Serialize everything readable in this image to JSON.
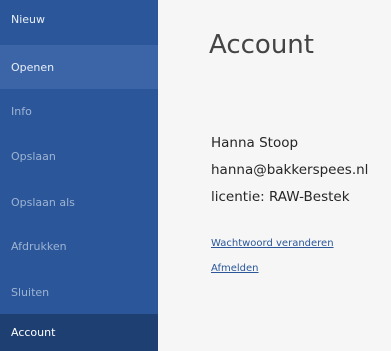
{
  "sidebar": {
    "items": [
      {
        "label": "Nieuw"
      },
      {
        "label": "Openen"
      },
      {
        "label": "Info"
      },
      {
        "label": "Opslaan"
      },
      {
        "label": "Opslaan als"
      },
      {
        "label": "Afdrukken"
      },
      {
        "label": "Sluiten"
      },
      {
        "label": "Account"
      }
    ],
    "selected": "Account",
    "hovered": "Openen"
  },
  "main": {
    "title": "Account",
    "user": {
      "name": "Hanna Stoop",
      "email": "hanna@bakkerspees.nl",
      "license": "licentie: RAW-Bestek"
    },
    "links": {
      "change_password": "Wachtwoord veranderen",
      "sign_out": "Afmelden"
    }
  },
  "colors": {
    "sidebar_bg": "#2b579a",
    "selected_bg": "#1d3f72",
    "hover_bg": "#3b65a6",
    "link": "#2b579a"
  }
}
